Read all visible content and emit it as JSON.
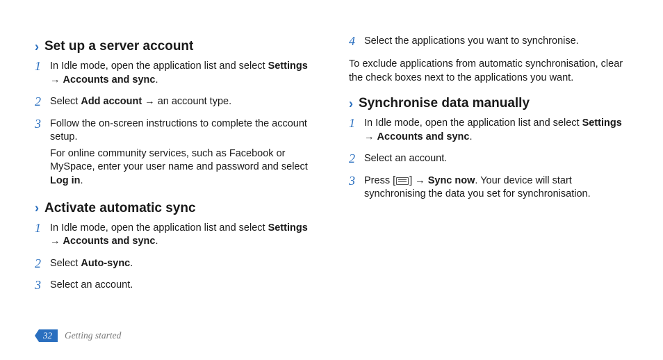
{
  "left": {
    "section1": {
      "title": "Set up a server account",
      "steps": [
        {
          "num": "1",
          "text_before": "In Idle mode, open the application list and select ",
          "bold1": "Settings",
          "arrow": " → ",
          "bold2": "Accounts and sync",
          "text_after": "."
        },
        {
          "num": "2",
          "text_before": "Select ",
          "bold1": "Add account",
          "text_after": " → an account type."
        },
        {
          "num": "3",
          "text_before": "Follow the on-screen instructions to complete the account setup.",
          "extra": "For online community services, such as Facebook or MySpace, enter your user name and password and select ",
          "extra_bold": "Log in",
          "extra_after": "."
        }
      ]
    },
    "section2": {
      "title": "Activate automatic sync",
      "steps": [
        {
          "num": "1",
          "text_before": "In Idle mode, open the application list and select ",
          "bold1": "Settings",
          "arrow": " → ",
          "bold2": "Accounts and sync",
          "text_after": "."
        },
        {
          "num": "2",
          "text_before": "Select ",
          "bold1": "Auto-sync",
          "text_after": "."
        },
        {
          "num": "3",
          "text_before": "Select an account."
        }
      ]
    }
  },
  "right": {
    "step4": {
      "num": "4",
      "text": "Select the applications you want to synchronise."
    },
    "note": "To exclude applications from automatic synchronisation, clear the check boxes next to the applications you want.",
    "section3": {
      "title": "Synchronise data manually",
      "steps": [
        {
          "num": "1",
          "text_before": "In Idle mode, open the application list and select ",
          "bold1": "Settings",
          "arrow": " → ",
          "bold2": "Accounts and sync",
          "text_after": "."
        },
        {
          "num": "2",
          "text_before": "Select an account."
        },
        {
          "num": "3",
          "text_before": "Press [",
          "icon": true,
          "text_mid": "] → ",
          "bold1": "Sync now",
          "text_after": ". Your device will start synchronising the data you set for synchronisation."
        }
      ]
    }
  },
  "footer": {
    "page": "32",
    "label": "Getting started"
  }
}
